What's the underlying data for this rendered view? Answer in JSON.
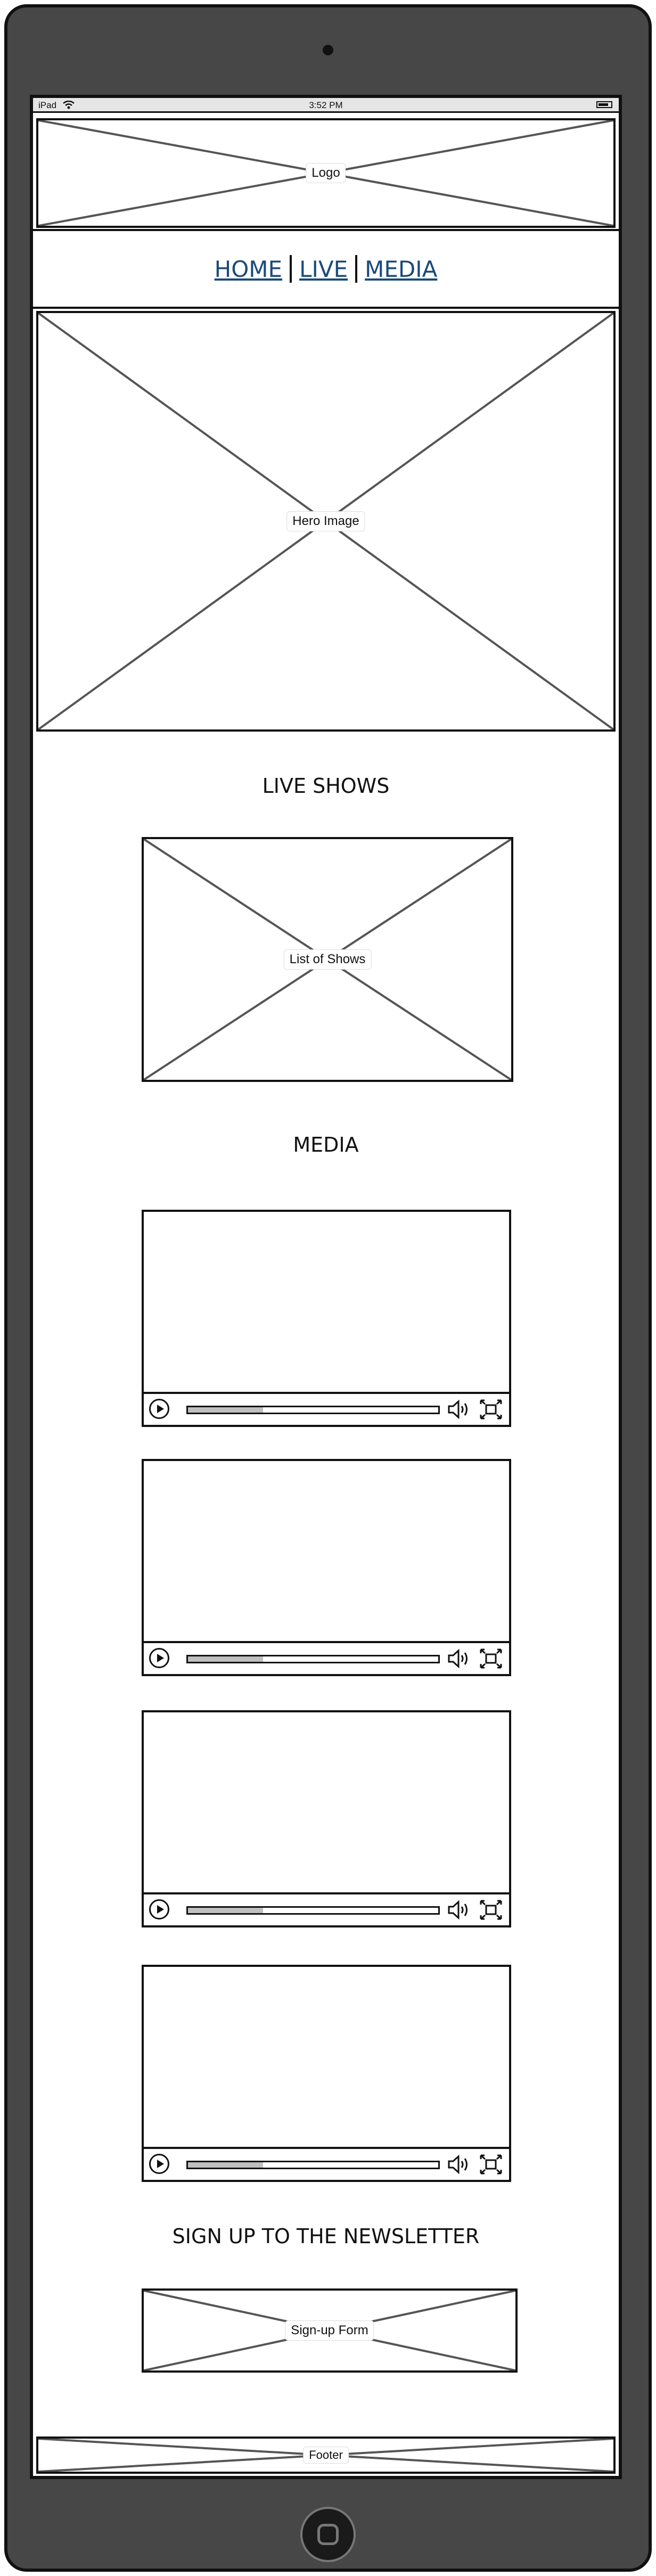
{
  "status_bar": {
    "carrier": "iPad",
    "wifi_icon": "wifi-icon",
    "time": "3:52 PM",
    "battery_icon": "battery-icon"
  },
  "header": {
    "logo_label": "Logo"
  },
  "nav": {
    "items": [
      {
        "label": "HOME"
      },
      {
        "label": "LIVE"
      },
      {
        "label": "MEDIA"
      }
    ],
    "link_color": "#1a4a7a"
  },
  "hero": {
    "label": "Hero Image"
  },
  "live": {
    "heading": "LIVE SHOWS",
    "list_label": "List of Shows"
  },
  "media": {
    "heading": "MEDIA",
    "videos": [
      {
        "progress": 0.3,
        "play_icon": "play-icon",
        "volume_icon": "volume-icon",
        "fullscreen_icon": "fullscreen-icon"
      },
      {
        "progress": 0.3,
        "play_icon": "play-icon",
        "volume_icon": "volume-icon",
        "fullscreen_icon": "fullscreen-icon"
      },
      {
        "progress": 0.3,
        "play_icon": "play-icon",
        "volume_icon": "volume-icon",
        "fullscreen_icon": "fullscreen-icon"
      },
      {
        "progress": 0.3,
        "play_icon": "play-icon",
        "volume_icon": "volume-icon",
        "fullscreen_icon": "fullscreen-icon"
      }
    ]
  },
  "newsletter": {
    "heading": "SIGN UP TO THE NEWSLETTER",
    "form_label": "Sign-up Form"
  },
  "footer": {
    "label": "Footer"
  },
  "device": {
    "frame_color": "#474747",
    "home_button_icon": "home-button-icon"
  }
}
